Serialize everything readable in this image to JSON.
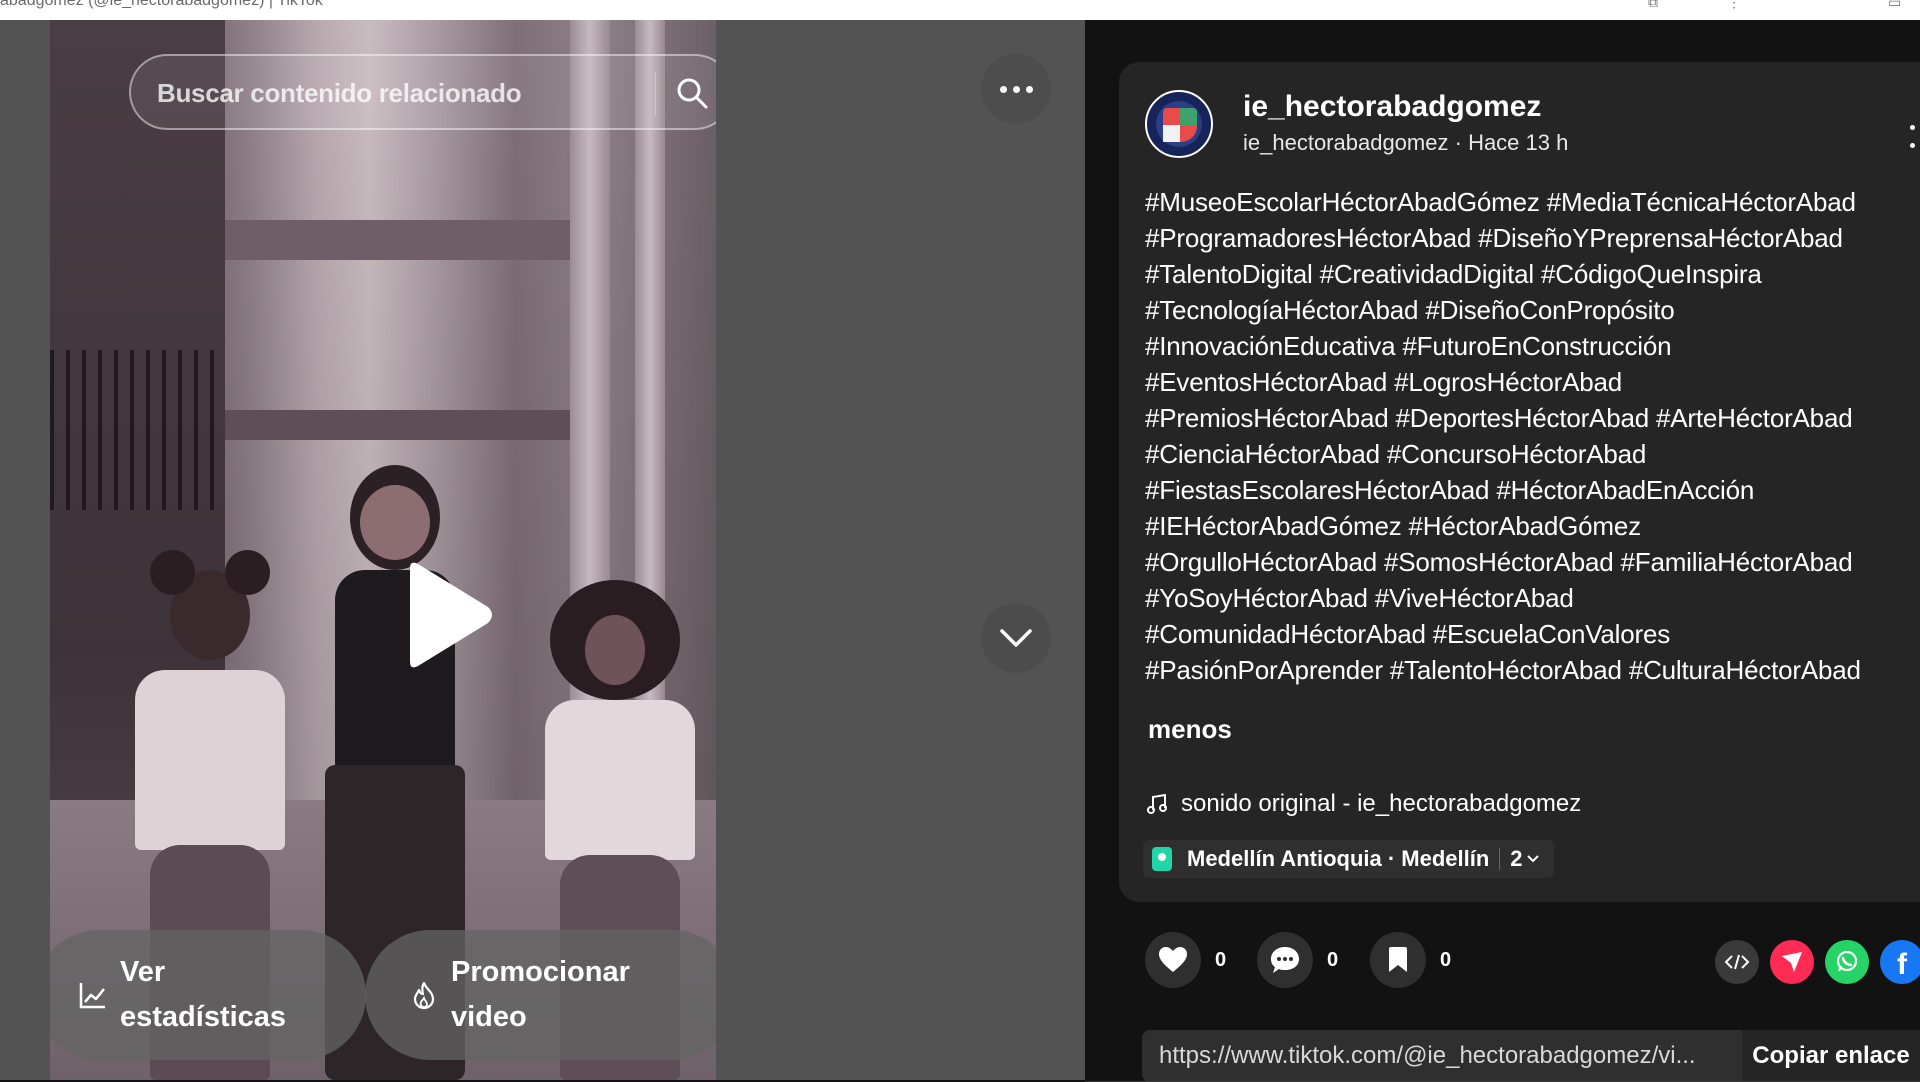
{
  "window": {
    "title": "abadgomez (@ie_hectorabadgomez) | TikTok"
  },
  "search": {
    "placeholder": "Buscar contenido relacionado"
  },
  "video_controls": {
    "stats_label": "Ver estadísticas",
    "promote_label": "Promocionar video"
  },
  "post": {
    "username": "ie_hectorabadgomez",
    "handle": "ie_hectorabadgomez",
    "separator": "·",
    "time": "Hace 13 h",
    "description_lines": [
      "#MuseoEscolarHéctorAbadGómez #MediaTécnicaHéctorAbad",
      "#ProgramadoresHéctorAbad #DiseñoYPreprensaHéctorAbad",
      "#TalentoDigital #CreatividadDigital #CódigoQueInspira",
      "#TecnologíaHéctorAbad #DiseñoConPropósito",
      "#InnovaciónEducativa #FuturoEnConstrucción",
      "#EventosHéctorAbad #LogrosHéctorAbad",
      "#PremiosHéctorAbad #DeportesHéctorAbad #ArteHéctorAbad",
      "#CienciaHéctorAbad #ConcursoHéctorAbad",
      "#FiestasEscolaresHéctorAbad #HéctorAbadEnAcción",
      "#IEHéctorAbadGómez #HéctorAbadGómez",
      "#OrgulloHéctorAbad #SomosHéctorAbad #FamiliaHéctorAbad",
      "#YoSoyHéctorAbad #ViveHéctorAbad",
      "#ComunidadHéctorAbad #EscuelaConValores",
      "#PasiónPorAprender #TalentoHéctorAbad #CulturaHéctorAbad"
    ],
    "less_label": "menos",
    "sound": "sonido original - ie_hectorabadgomez",
    "location": "Medellín Antioquia · Medellín",
    "location_count": "2"
  },
  "actions": {
    "likes": "0",
    "comments": "0",
    "saves": "0"
  },
  "share": {
    "url": "https://www.tiktok.com/@ie_hectorabadgomez/vi...",
    "copy_label": "Copiar enlace"
  },
  "colors": {
    "background": "#121212",
    "card": "#252525",
    "video_backdrop": "#535353",
    "tiktok_red": "#fe2c55",
    "whatsapp_green": "#25d366",
    "facebook_blue": "#1877f2"
  }
}
